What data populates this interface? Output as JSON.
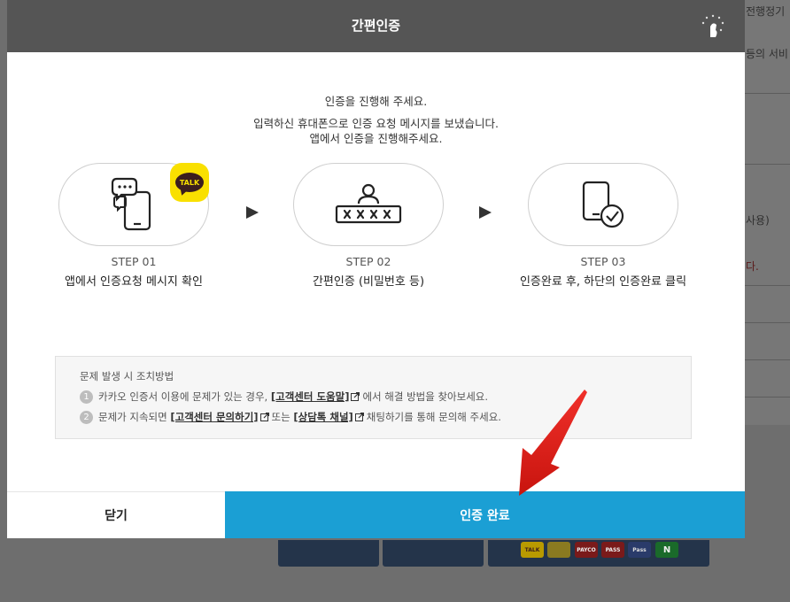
{
  "modal": {
    "title": "간편인증",
    "intro": {
      "line1": "인증을 진행해 주세요.",
      "line2": "입력하신 휴대폰으로 인증 요청 메시지를 보냈습니다.",
      "line3": "앱에서 인증을 진행해주세요."
    },
    "talk_badge": "TALK",
    "steps": [
      {
        "num": "STEP 01",
        "desc": "앱에서 인증요청 메시지 확인",
        "icon": "phone-chat-icon"
      },
      {
        "num": "STEP 02",
        "desc": "간편인증 (비밀번호 등)",
        "icon": "user-password-icon"
      },
      {
        "num": "STEP 03",
        "desc": "인증완료 후, 하단의 인증완료 클릭",
        "icon": "phone-check-icon"
      }
    ],
    "help": {
      "title": "문제 발생 시 조치방법",
      "row1": {
        "num": "1",
        "pre": "카카오 인증서 이용에 문제가 있는 경우,",
        "link": "[고객센터 도움말]",
        "post": "에서 해결 방법을 찾아보세요."
      },
      "row2": {
        "num": "2",
        "pre": "문제가 지속되면",
        "link1": "[고객센터 문의하기]",
        "mid": "또는",
        "link2": "[상담톡 채널]",
        "post": "채팅하기를 통해 문의해 주세요."
      }
    },
    "buttons": {
      "close": "닫기",
      "complete": "인증 완료"
    }
  },
  "background": {
    "texts": [
      "전행정기",
      "등의 서비",
      "사용)",
      "다."
    ],
    "logos": [
      "TALK",
      "PAYCO",
      "PASS",
      "Pass",
      "N"
    ]
  },
  "colors": {
    "header": "#555555",
    "complete_button": "#1b9fd4",
    "kakao_yellow": "#f9e000",
    "annotation_red": "#e8201a"
  }
}
